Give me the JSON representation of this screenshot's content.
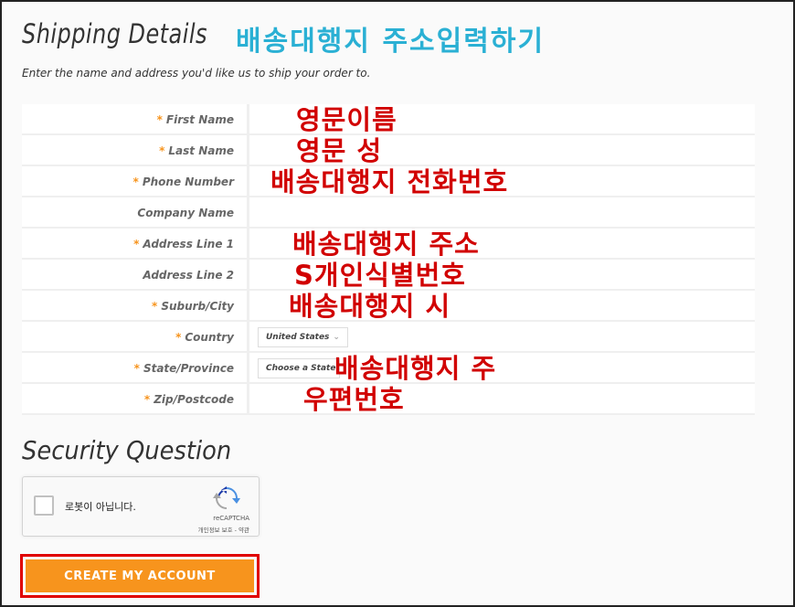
{
  "header": {
    "title": "Shipping Details",
    "annotation": "배송대행지 주소입력하기",
    "subtitle": "Enter the name and address you'd like us to ship your order to."
  },
  "form": {
    "required_mark": "*",
    "rows": [
      {
        "label": "First Name",
        "required": true,
        "note": "영문이름"
      },
      {
        "label": "Last Name",
        "required": true,
        "note": "영문 성"
      },
      {
        "label": "Phone Number",
        "required": true,
        "note": "배송대행지 전화번호"
      },
      {
        "label": "Company Name",
        "required": false,
        "note": ""
      },
      {
        "label": "Address Line 1",
        "required": true,
        "note": "배송대행지 주소"
      },
      {
        "label": "Address Line 2",
        "required": false,
        "note": "S개인식별번호"
      },
      {
        "label": "Suburb/City",
        "required": true,
        "note": "배송대행지 시"
      },
      {
        "label": "Country",
        "required": true,
        "select": "United States"
      },
      {
        "label": "State/Province",
        "required": true,
        "select": "Choose a State",
        "note": "배송대행지 주"
      },
      {
        "label": "Zip/Postcode",
        "required": true,
        "note": "우편번호"
      }
    ]
  },
  "security": {
    "title": "Security Question",
    "recaptcha_label": "로봇이 아닙니다.",
    "recaptcha_brand": "reCAPTCHA",
    "recaptcha_terms": "개인정보 보호 - 약관"
  },
  "submit": {
    "label": "CREATE MY ACCOUNT"
  },
  "colors": {
    "accent": "#f7941d",
    "annotation_red": "#d10000",
    "annotation_blue": "#2ab0d4"
  }
}
